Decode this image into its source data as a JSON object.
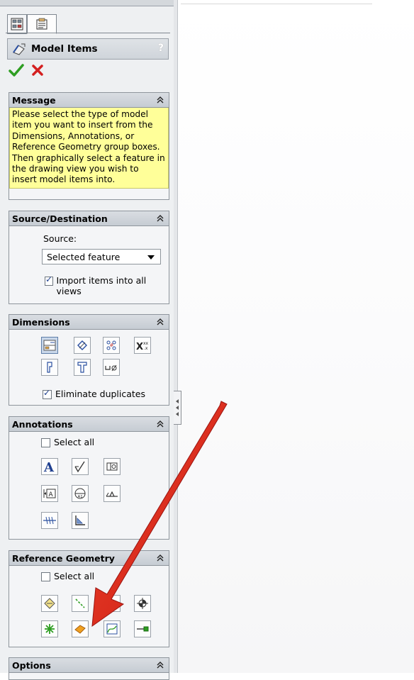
{
  "panel": {
    "title": "Model Items",
    "help": "?",
    "groups": {
      "message": {
        "title": "Message",
        "text": "Please select the type of model item you want to insert from the Dimensions, Annotations, or Reference Geometry group boxes. Then graphically select a feature in the drawing view you wish to insert model items into."
      },
      "source": {
        "title": "Source/Destination",
        "source_label": "Source:",
        "source_value": "Selected feature",
        "import_label": "Import items into all views",
        "import_checked": true
      },
      "dimensions": {
        "title": "Dimensions",
        "eliminate_label": "Eliminate duplicates",
        "eliminate_checked": true
      },
      "annotations": {
        "title": "Annotations",
        "select_all_label": "Select all"
      },
      "reference": {
        "title": "Reference Geometry",
        "select_all_label": "Select all"
      },
      "options": {
        "title": "Options"
      }
    }
  },
  "colors": {
    "message_bg": "#ffff99",
    "accent_arrow": "#e8261c",
    "ok_green": "#2e9e22",
    "cancel_red": "#d42020"
  }
}
